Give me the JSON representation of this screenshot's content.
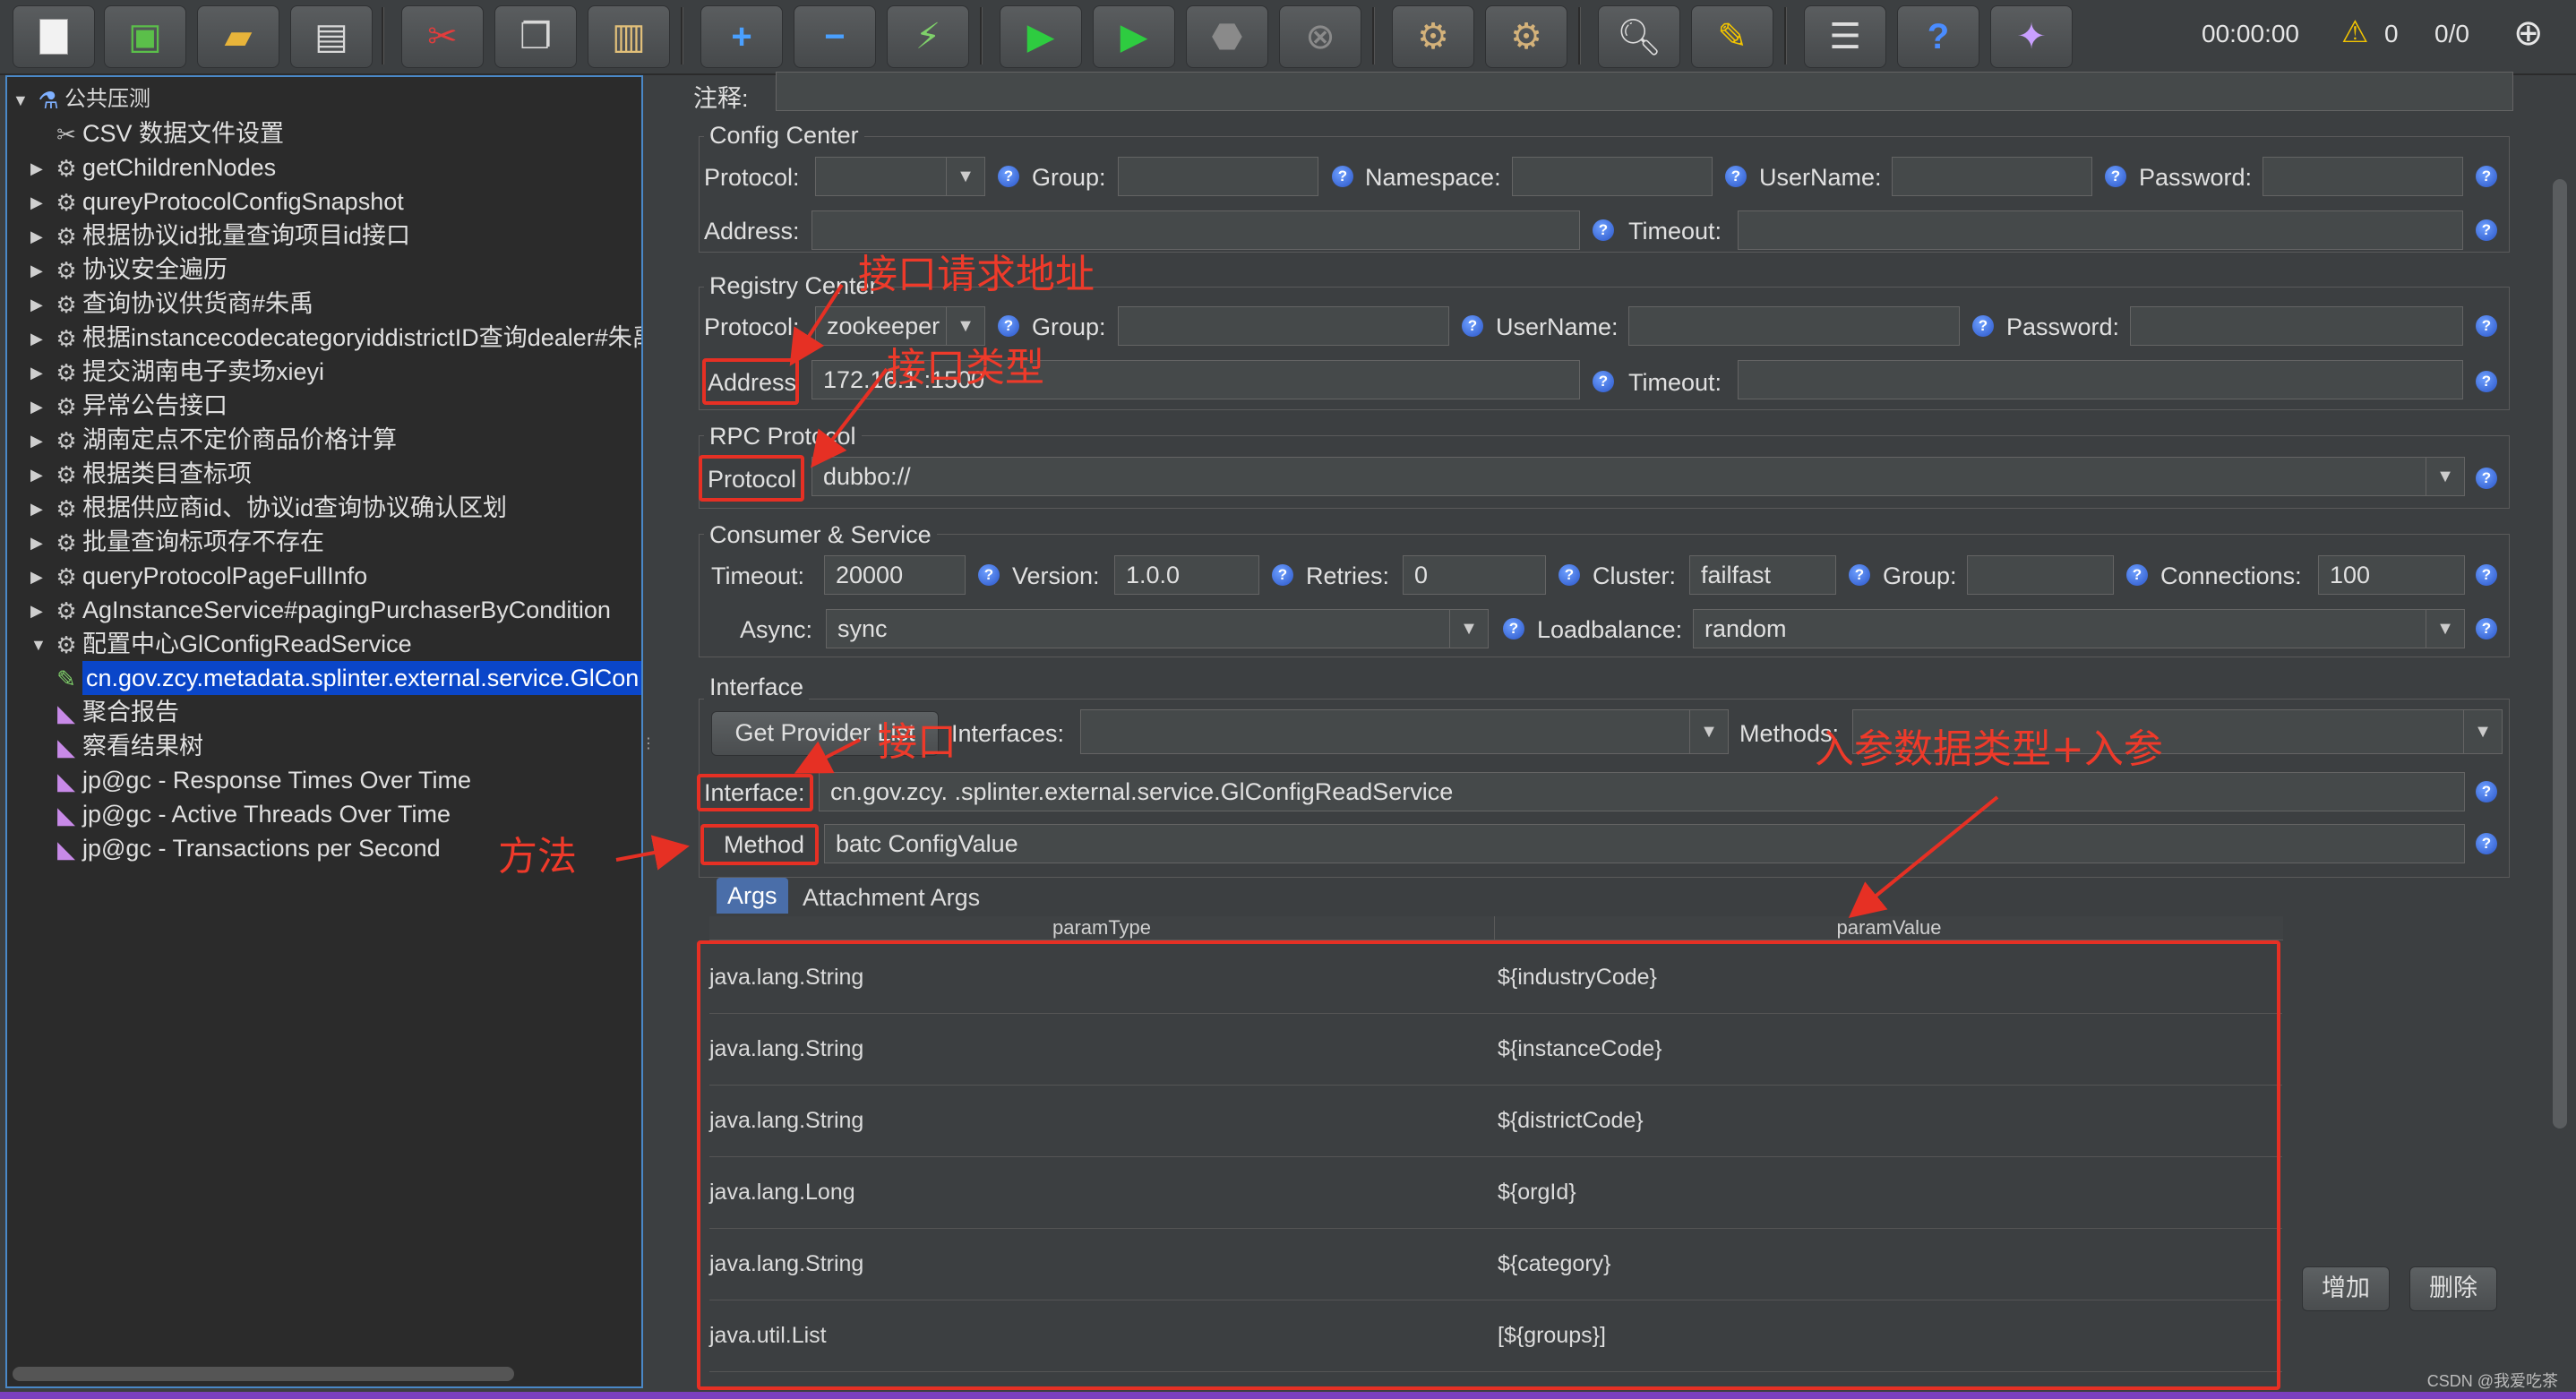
{
  "toolbar": {
    "icons": [
      "new-icon",
      "templates-icon",
      "open-icon",
      "save-icon",
      "cut-icon",
      "copy-icon",
      "paste-icon",
      "expand-icon",
      "collapse-icon",
      "toggle-icon",
      "start-icon",
      "start-no-pause-icon",
      "stop-icon",
      "shutdown-icon",
      "clear-icon",
      "clear-all-icon",
      "search-icon",
      "reset-search-icon",
      "function-helper-icon",
      "help-icon",
      "remote-icon"
    ],
    "elapsed": "00:00:00",
    "warnings": "0",
    "threads": "0/0",
    "colors": {
      "start": "#2ecc40",
      "stop": "#9a9a9a"
    }
  },
  "tree": {
    "root": "公共压测",
    "items": [
      {
        "label": "CSV 数据文件设置",
        "dim": false
      },
      {
        "label": "getChildrenNodes",
        "dim": true
      },
      {
        "label": "qureyProtocolConfigSnapshot",
        "dim": true
      },
      {
        "label": "根据协议id批量查询项目id接口",
        "dim": true
      },
      {
        "label": "协议安全遍历",
        "dim": true
      },
      {
        "label": "查询协议供货商#朱禹",
        "dim": true
      },
      {
        "label": "根据instancecodecategoryiddistrictID查询dealer#朱禹",
        "dim": true
      },
      {
        "label": "提交湖南电子卖场xieyi",
        "dim": true
      },
      {
        "label": "异常公告接口",
        "dim": true
      },
      {
        "label": "湖南定点不定价商品价格计算",
        "dim": true
      },
      {
        "label": "根据类目查标项",
        "dim": true
      },
      {
        "label": "根据供应商id、协议id查询协议确认区划",
        "dim": true
      },
      {
        "label": "批量查询标项存不存在",
        "dim": true
      },
      {
        "label": "queryProtocolPageFullInfo",
        "dim": true
      },
      {
        "label": "AgInstanceService#pagingPurchaserByCondition",
        "dim": true
      },
      {
        "label": "配置中心GlConfigReadService",
        "dim": false
      },
      {
        "label": "cn.gov.zcy.metadata.splinter.external.service.GlCon",
        "dim": false
      },
      {
        "label": "聚合报告",
        "dim": false
      },
      {
        "label": "察看结果树",
        "dim": false
      },
      {
        "label": "jp@gc - Response Times Over Time",
        "dim": false
      },
      {
        "label": "jp@gc - Active Threads Over Time",
        "dim": false
      },
      {
        "label": "jp@gc - Transactions per Second",
        "dim": false
      }
    ]
  },
  "form": {
    "comment_label": "注释:",
    "config_center": {
      "title": "Config Center",
      "protocol_label": "Protocol:",
      "protocol_value": "",
      "group_label": "Group:",
      "namespace_label": "Namespace:",
      "username_label": "UserName:",
      "password_label": "Password:",
      "address_label": "Address:",
      "timeout_label": "Timeout:"
    },
    "registry_center": {
      "title": "Registry Center",
      "protocol_label": "Protocol:",
      "protocol_value": "zookeeper",
      "group_label": "Group:",
      "username_label": "UserName:",
      "password_label": "Password:",
      "address_label": "Address",
      "address_value": "172.16.1     :1500",
      "timeout_label": "Timeout:"
    },
    "rpc_protocol": {
      "title": "RPC Protocol",
      "protocol_label": "Protocol",
      "protocol_value": "dubbo://"
    },
    "consumer": {
      "title": "Consumer & Service",
      "timeout_label": "Timeout:",
      "timeout_value": "20000",
      "version_label": "Version:",
      "version_value": "1.0.0",
      "retries_label": "Retries:",
      "retries_value": "0",
      "cluster_label": "Cluster:",
      "cluster_value": "failfast",
      "group_label": "Group:",
      "group_value": "",
      "connections_label": "Connections:",
      "connections_value": "100",
      "async_label": "Async:",
      "async_value": "sync",
      "loadbalance_label": "Loadbalance:",
      "loadbalance_value": "random"
    },
    "interface": {
      "title": "Interface",
      "get_provider_list": "Get Provider List",
      "interfaces_label": "Interfaces:",
      "methods_label": "Methods:",
      "interface_label": "Interface:",
      "interface_value": "cn.gov.zcy.          .splinter.external.service.GlConfigReadService",
      "method_label": "Method",
      "method_value": "batc           ConfigValue"
    },
    "tabs": [
      "Args",
      "Attachment Args"
    ],
    "args_table": {
      "headers": [
        "paramType",
        "paramValue"
      ],
      "rows": [
        [
          "java.lang.String",
          "${industryCode}"
        ],
        [
          "java.lang.String",
          "${instanceCode}"
        ],
        [
          "java.lang.String",
          "${districtCode}"
        ],
        [
          "java.lang.Long",
          "${orgId}"
        ],
        [
          "java.lang.String",
          "${category}"
        ],
        [
          "java.util.List",
          "[${groups}]"
        ]
      ]
    },
    "add_button": "增加",
    "delete_button": "删除"
  },
  "annotations": {
    "address": "接口请求地址",
    "type": "接口类型",
    "interface": "接口",
    "method": "方法",
    "params": "入参数据类型+入参",
    "color": "#e63024"
  },
  "watermark": "CSDN @我爱吃茶"
}
